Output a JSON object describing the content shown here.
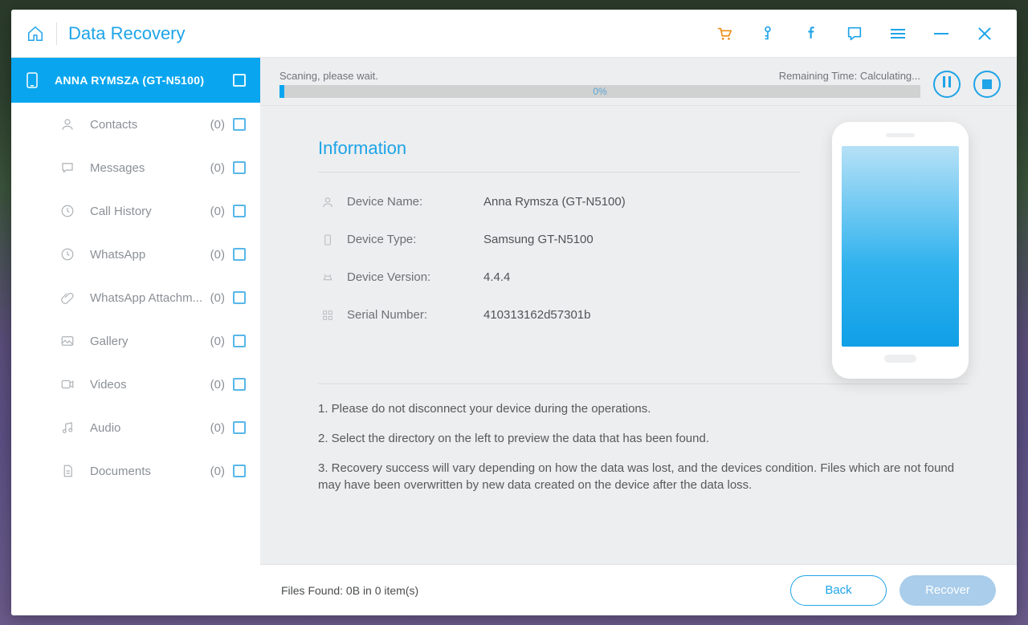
{
  "header": {
    "title": "Data Recovery"
  },
  "device": {
    "label": "ANNA RYMSZA (GT-N5100)"
  },
  "categories": [
    {
      "id": "contacts",
      "label": "Contacts",
      "count": "(0)"
    },
    {
      "id": "messages",
      "label": "Messages",
      "count": "(0)"
    },
    {
      "id": "callhist",
      "label": "Call History",
      "count": "(0)"
    },
    {
      "id": "whatsapp",
      "label": "WhatsApp",
      "count": "(0)"
    },
    {
      "id": "waattach",
      "label": "WhatsApp Attachm...",
      "count": "(0)"
    },
    {
      "id": "gallery",
      "label": "Gallery",
      "count": "(0)"
    },
    {
      "id": "videos",
      "label": "Videos",
      "count": "(0)"
    },
    {
      "id": "audio",
      "label": "Audio",
      "count": "(0)"
    },
    {
      "id": "documents",
      "label": "Documents",
      "count": "(0)"
    }
  ],
  "scan": {
    "status": "Scaning, please wait.",
    "remaining": "Remaining Time: Calculating...",
    "percent": "0%"
  },
  "info": {
    "title": "Information",
    "device_name_label": "Device Name:",
    "device_name": "Anna Rymsza (GT-N5100)",
    "device_type_label": "Device Type:",
    "device_type": "Samsung GT-N5100",
    "device_version_label": "Device Version:",
    "device_version": "4.4.4",
    "serial_label": "Serial Number:",
    "serial": "410313162d57301b"
  },
  "notes": {
    "n1": "1. Please do not disconnect your device during the operations.",
    "n2": "2. Select the directory on the left to preview the data that has been found.",
    "n3": "3. Recovery success will vary depending on how the data was lost, and the devices condition. Files which are not found may have been overwritten by new data created on the device after the data loss."
  },
  "footer": {
    "status": "Files Found: 0B in 0 item(s)",
    "back": "Back",
    "recover": "Recover"
  }
}
